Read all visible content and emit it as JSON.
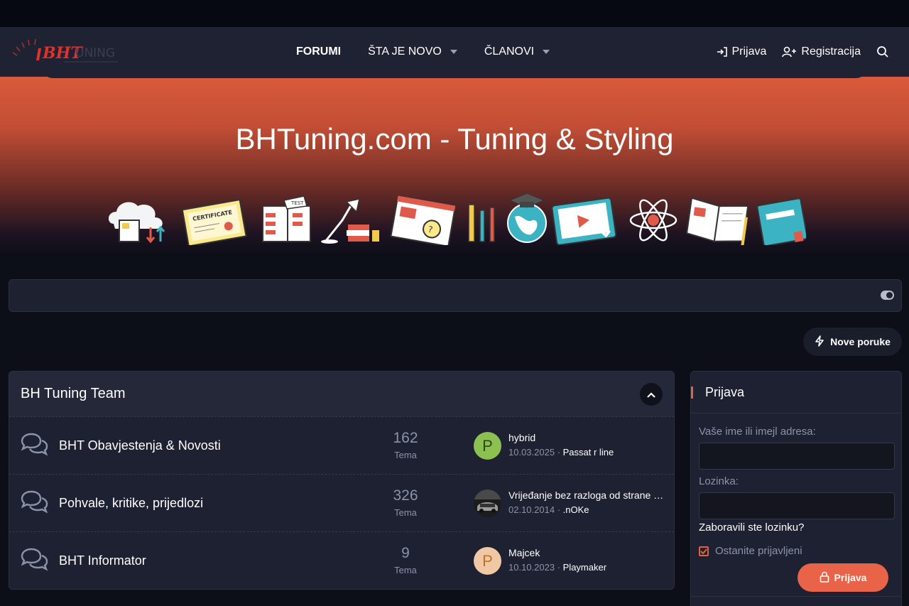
{
  "nav": {
    "logo_text": "BHTuning",
    "items": [
      {
        "label": "FORUMI"
      },
      {
        "label": "ŠTA JE NOVO"
      },
      {
        "label": "ČLANOVI"
      }
    ],
    "login_label": "Prijava",
    "register_label": "Registracija"
  },
  "hero": {
    "title": "BHTuning.com - Tuning & Styling",
    "banner_icon_labels": [
      "CERTIFICATE",
      "TEST"
    ]
  },
  "toolbar": {
    "new_posts_label": "Nove poruke"
  },
  "category": {
    "title": "BH Tuning Team",
    "forums": [
      {
        "title": "BHT Obavjestenja & Novosti",
        "count": "162",
        "count_label": "Tema",
        "avatar_letter": "P",
        "avatar_color": "#8cc152",
        "last_title": "hybrid",
        "last_date": "10.03.2025",
        "last_user": "Passat r line"
      },
      {
        "title": "Pohvale, kritike, prijedlozi",
        "count": "326",
        "count_label": "Tema",
        "avatar_letter": "",
        "avatar_color": "#3a3a3a",
        "last_title": "Vrijeđanje bez razloga od strane moderatora",
        "last_date": "02.10.2014",
        "last_user": ".nOKe"
      },
      {
        "title": "BHT Informator",
        "count": "9",
        "count_label": "Tema",
        "avatar_letter": "P",
        "avatar_color": "#f0c9a4",
        "last_title": "Majcek",
        "last_date": "10.10.2023",
        "last_user": "Playmaker"
      }
    ]
  },
  "login": {
    "title": "Prijava",
    "username_label": "Vaše ime ili imejl adresa:",
    "password_label": "Lozinka:",
    "forgot_label": "Zaboravili ste lozinku?",
    "remember_label": "Ostanite prijavljeni",
    "remember_checked": true,
    "submit_label": "Prijava"
  },
  "colors": {
    "accent": "#e86348",
    "background": "#0c0e18",
    "panel": "#1e2131"
  }
}
